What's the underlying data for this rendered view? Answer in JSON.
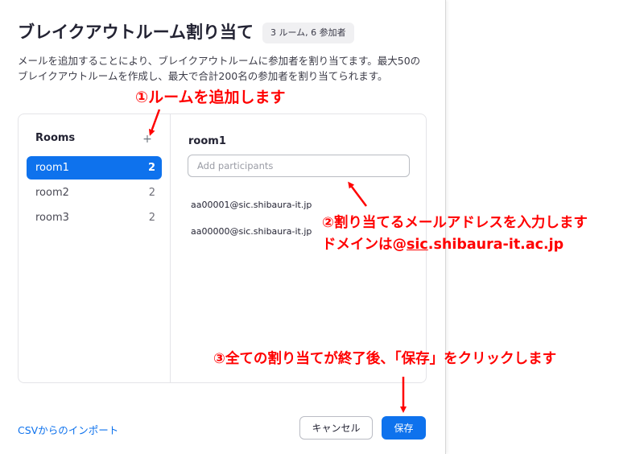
{
  "dialog": {
    "title": "ブレイクアウトルーム割り当て",
    "count_badge": "3 ルーム, 6 参加者",
    "description": "メールを追加することにより、ブレイクアウトルームに参加者を割り当てます。最大50のブレイクアウトルームを作成し、最大で合計200名の参加者を割り当てられます。"
  },
  "rooms": {
    "heading": "Rooms",
    "add_icon": "plus-icon",
    "add_symbol": "+",
    "items": [
      {
        "name": "room1",
        "count": "2",
        "selected": true
      },
      {
        "name": "room2",
        "count": "2",
        "selected": false
      },
      {
        "name": "room3",
        "count": "2",
        "selected": false
      }
    ]
  },
  "detail": {
    "room_title": "room1",
    "add_placeholder": "Add participants",
    "participants": [
      "aa00001@sic.shibaura-it.jp",
      "aa00000@sic.shibaura-it.jp"
    ]
  },
  "footer": {
    "import_label": "CSVからのインポート",
    "cancel_label": "キャンセル",
    "save_label": "保存"
  },
  "annotations": {
    "step1": "①ルームを追加します",
    "step2_line1": "②割り当てるメールアドレスを入力します",
    "step2_line2_prefix": "ドメインは@",
    "step2_line2_underlined": "sic",
    "step2_line2_suffix": ".shibaura-it.ac.jp",
    "step3": "③全ての割り当てが終了後、「保存」をクリックします"
  },
  "colors": {
    "accent": "#0e72ed",
    "annotation": "#ff0000"
  }
}
